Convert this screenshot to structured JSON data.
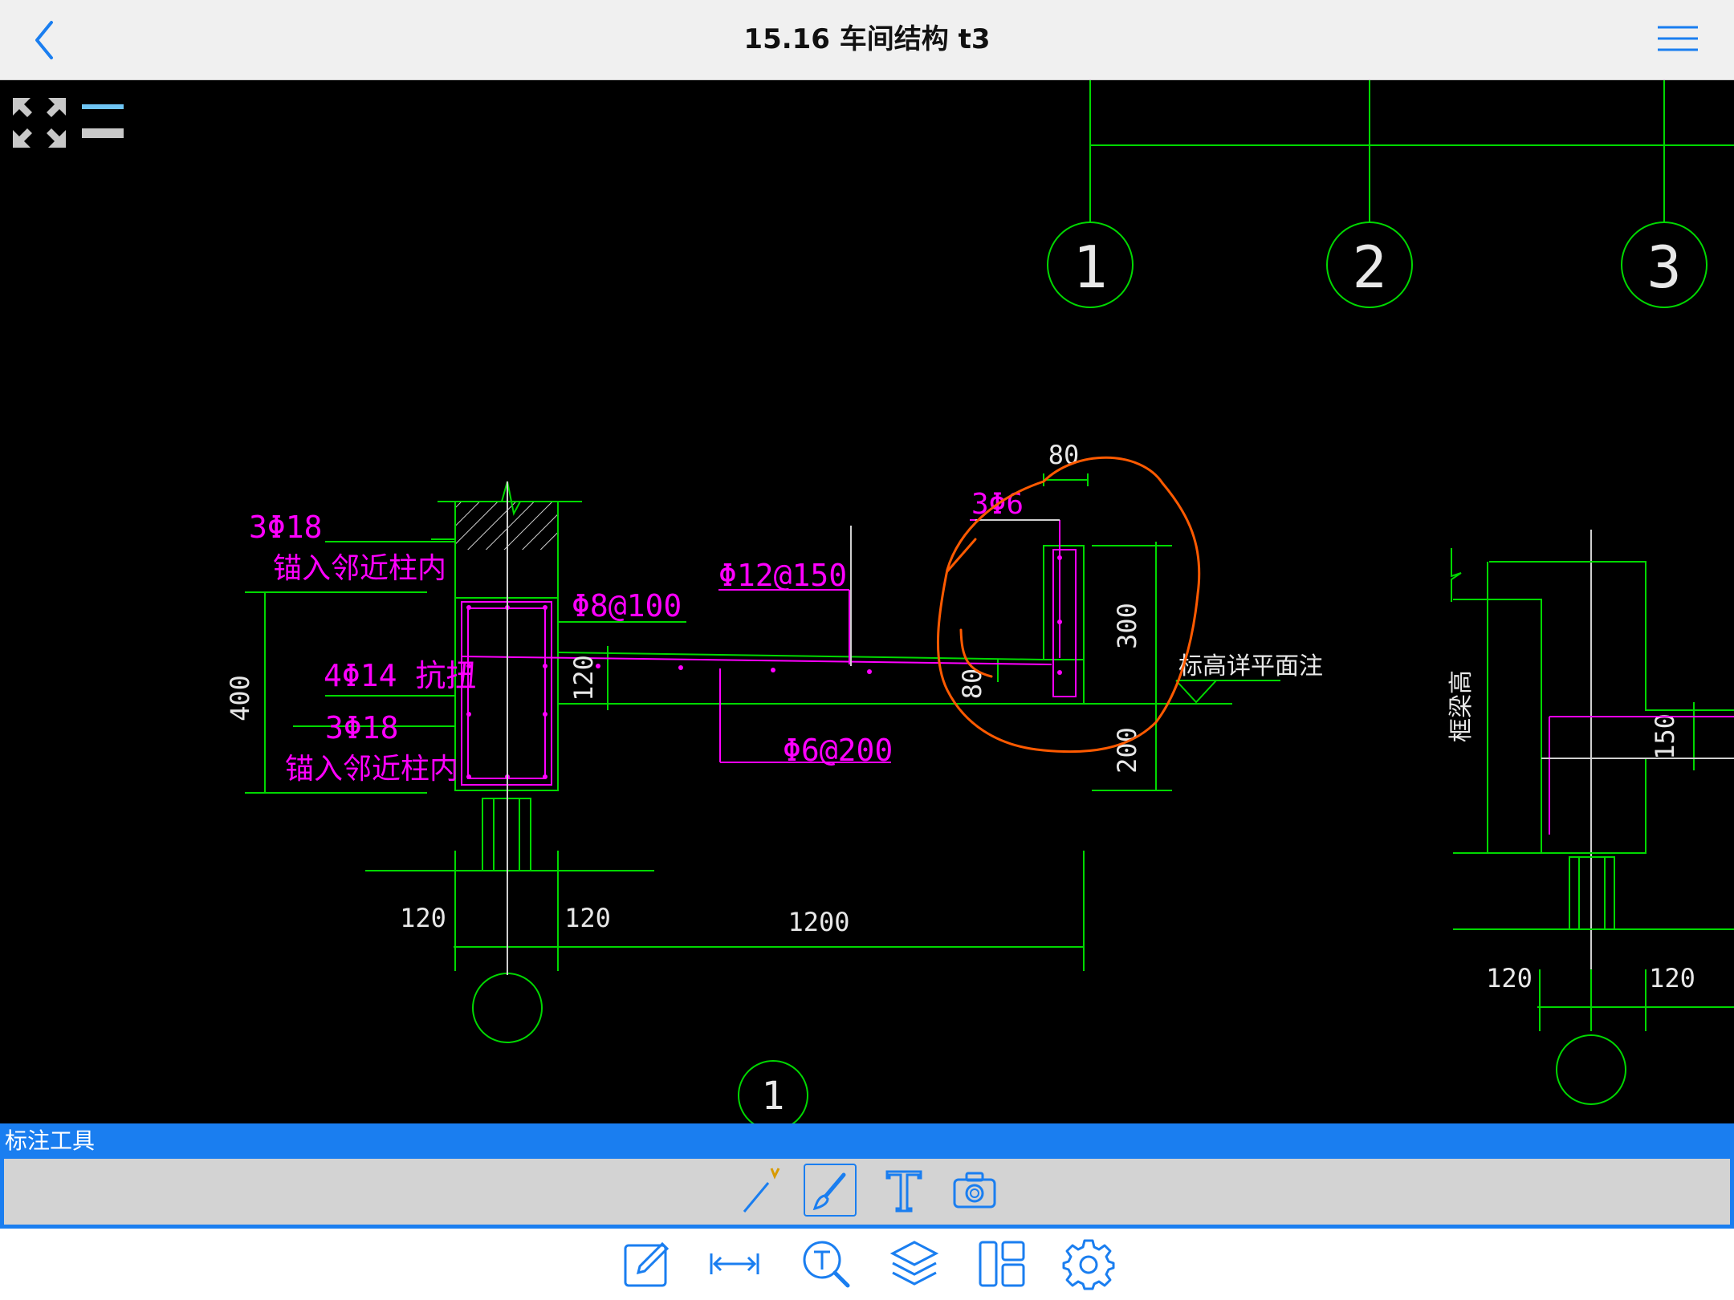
{
  "header": {
    "title": "15.16 车间结构 t3",
    "back_icon": "chevron-left-icon",
    "menu_icon": "hamburger-menu-icon"
  },
  "drawing": {
    "axis_labels": [
      "1",
      "2",
      "3"
    ],
    "axis_bottom": "1",
    "texts": {
      "top_bar": "3Φ18",
      "anchor_top": "锚入邻近柱内",
      "stirrup": "Φ8@100",
      "slab_top_bar": "Φ12@150",
      "side_bar": "3Φ6",
      "torsion": "4Φ14 抗扭",
      "bottom_bar": "3Φ18",
      "anchor_bottom": "锚入邻近柱内",
      "slab_bottom_bar": "Φ6@200",
      "elev_note": "标高详平面注",
      "beam_height": "框梁高"
    },
    "dims": {
      "d400": "400",
      "d120_slab": "120",
      "d80_top": "80",
      "d300": "300",
      "d80_side": "80",
      "d200": "200",
      "d120_a": "120",
      "d120_b": "120",
      "d1200": "1200",
      "d150": "150",
      "d120_c": "120",
      "d120_d": "120"
    }
  },
  "annotation_panel": {
    "title": "标注工具",
    "tools": [
      "pen-v-icon",
      "brush-icon",
      "text-tool-icon",
      "camera-icon"
    ]
  },
  "bottom_toolbar": {
    "tools": [
      "edit-icon",
      "measure-icon",
      "text-search-icon",
      "layers-icon",
      "layout-icon",
      "settings-icon"
    ]
  },
  "colors": {
    "accent": "#1a7ef0",
    "cad_green": "#00ff00",
    "cad_magenta": "#ff00ff",
    "cad_orange": "#ff5a00"
  }
}
